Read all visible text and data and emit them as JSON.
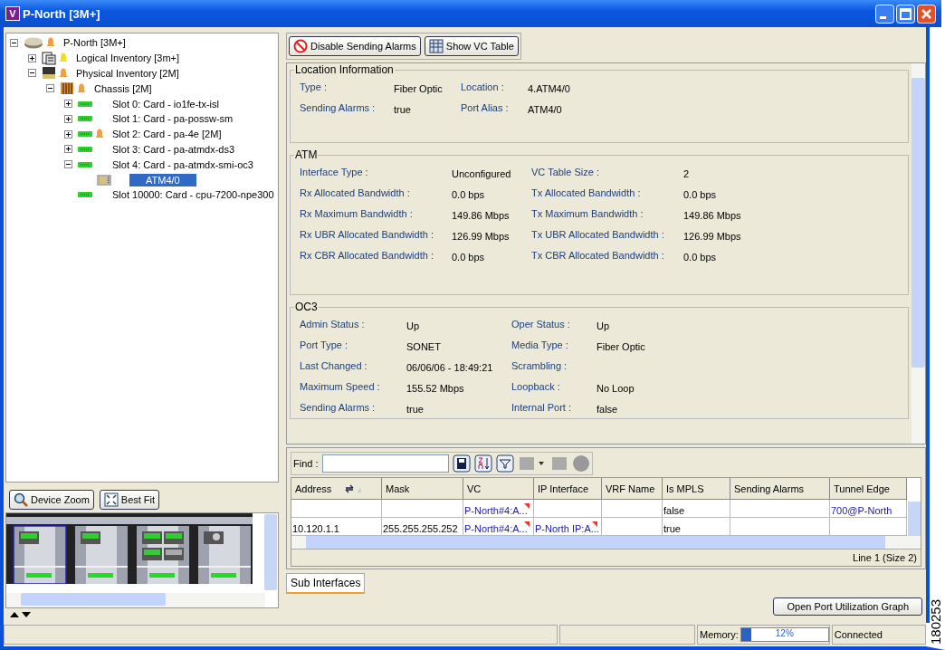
{
  "window": {
    "icon_letter": "V",
    "title": "P-North [3M+]"
  },
  "tree": [
    {
      "label": "P-North [3M+]",
      "kind": "device",
      "color": "#f0a040",
      "expanded": true,
      "selected": false,
      "children": [
        {
          "label": "Logical Inventory [3m+]",
          "kind": "logical",
          "color": "#f0e020",
          "expanded": false,
          "selected": false
        },
        {
          "label": "Physical Inventory [2M]",
          "kind": "physical",
          "color": "#f0a040",
          "expanded": true,
          "selected": false,
          "children": [
            {
              "label": "Chassis [2M]",
              "kind": "chassis",
              "color": "#f0a040",
              "expanded": true,
              "selected": false,
              "children": [
                {
                  "label": "Slot 0:  Card - io1fe-tx-isl",
                  "kind": "card",
                  "expanded": false,
                  "selected": false
                },
                {
                  "label": "Slot 1:  Card - pa-possw-sm",
                  "kind": "card",
                  "expanded": false,
                  "selected": false
                },
                {
                  "label": "Slot 2:  Card - pa-4e [2M]",
                  "kind": "card",
                  "color": "#f0a040",
                  "expanded": false,
                  "selected": false
                },
                {
                  "label": "Slot 3:  Card - pa-atmdx-ds3",
                  "kind": "card",
                  "expanded": false,
                  "selected": false
                },
                {
                  "label": "Slot 4:  Card - pa-atmdx-smi-oc3",
                  "kind": "card",
                  "expanded": true,
                  "selected": false,
                  "children": [
                    {
                      "label": "ATM4/0",
                      "kind": "port",
                      "selected": true
                    }
                  ]
                },
                {
                  "label": "Slot 10000:  Card - cpu-7200-npe300",
                  "kind": "card",
                  "selected": false
                }
              ]
            }
          ]
        }
      ]
    }
  ],
  "view_buttons": [
    {
      "label": "Device Zoom"
    },
    {
      "label": "Best Fit"
    }
  ],
  "toolbar": [
    {
      "label": "Disable Sending Alarms"
    },
    {
      "label": "Show VC Table"
    }
  ],
  "sections": [
    {
      "title": "Location Information",
      "fields": [
        {
          "label": "Type :",
          "value": "Fiber Optic"
        },
        {
          "label": "Location :",
          "value": "4.ATM4/0"
        },
        {
          "label": "Sending Alarms :",
          "value": "true"
        },
        {
          "label": "Port Alias :",
          "value": "ATM4/0"
        }
      ]
    },
    {
      "title": "ATM",
      "fields": [
        {
          "label": "Interface Type :",
          "value": "Unconfigured"
        },
        {
          "label": "VC Table Size :",
          "value": "2"
        },
        {
          "label": "Rx Allocated Bandwidth :",
          "value": "0.0 bps"
        },
        {
          "label": "Tx Allocated Bandwidth :",
          "value": "0.0 bps"
        },
        {
          "label": "Rx Maximum Bandwidth :",
          "value": "149.86 Mbps"
        },
        {
          "label": "Tx Maximum Bandwidth :",
          "value": "149.86 Mbps"
        },
        {
          "label": "Rx UBR Allocated Bandwidth :",
          "value": "126.99 Mbps"
        },
        {
          "label": "Tx UBR Allocated Bandwidth :",
          "value": "126.99 Mbps"
        },
        {
          "label": "Rx CBR Allocated Bandwidth :",
          "value": "0.0 bps"
        },
        {
          "label": "Tx CBR Allocated Bandwidth :",
          "value": "0.0 bps"
        }
      ]
    },
    {
      "title": "OC3",
      "fields": [
        {
          "label": "Admin Status :",
          "value": "Up"
        },
        {
          "label": "Oper Status :",
          "value": "Up"
        },
        {
          "label": "Port Type :",
          "value": "SONET"
        },
        {
          "label": "Media Type :",
          "value": "Fiber Optic"
        },
        {
          "label": "Last Changed :",
          "value": "06/06/06 - 18:49:21"
        },
        {
          "label": "Scrambling :"
        },
        {
          "label": "Maximum Speed :",
          "value": "155.52 Mbps"
        },
        {
          "label": "Loopback :",
          "value": "No Loop"
        },
        {
          "label": "Sending Alarms :",
          "value": "true"
        },
        {
          "label": "Internal Port :",
          "value": "false"
        }
      ]
    }
  ],
  "find": {
    "label": "Find :"
  },
  "table": {
    "columns": [
      "Address",
      "Mask",
      "VC",
      "IP Interface",
      "VRF Name",
      "Is MPLS",
      "Sending Alarms",
      "Tunnel Edge"
    ],
    "rows": [
      {
        "cells": [
          {
            "kind": "empty"
          },
          {
            "kind": "empty"
          },
          {
            "kind": "link_flag",
            "text": "P-North#4:A..."
          },
          {
            "kind": "empty"
          },
          {
            "kind": "empty"
          },
          {
            "kind": "plain",
            "text": "false"
          },
          {
            "kind": "empty"
          },
          {
            "kind": "link",
            "text": "700@P-North"
          }
        ]
      },
      {
        "cells": [
          {
            "kind": "plain",
            "text": "10.120.1.1"
          },
          {
            "kind": "plain",
            "text": "255.255.255.252"
          },
          {
            "kind": "link_flag",
            "text": "P-North#4:A..."
          },
          {
            "kind": "link_flag",
            "text": "P-North IP:A..."
          },
          {
            "kind": "empty"
          },
          {
            "kind": "plain",
            "text": "true"
          },
          {
            "kind": "empty"
          },
          {
            "kind": "empty"
          }
        ]
      }
    ],
    "status": "Line 1 (Size 2)"
  },
  "tabs": [
    {
      "label": "Sub Interfaces",
      "selected": true
    }
  ],
  "graph_button": "Open Port Utilization Graph",
  "status_bar": {
    "memory_label": "Memory:",
    "memory": {
      "level": 0.12,
      "reading": "12%"
    },
    "connection": "Connected"
  },
  "figure_number": "180253"
}
